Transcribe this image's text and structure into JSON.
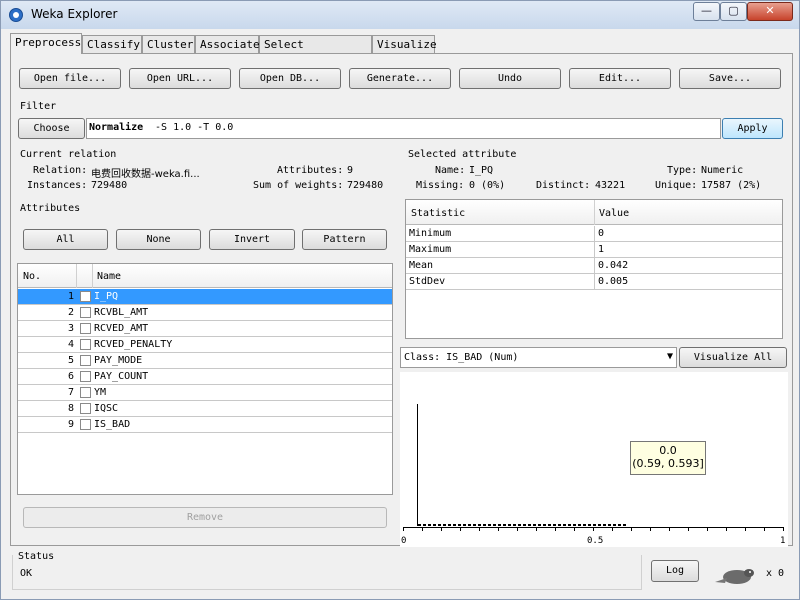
{
  "window": {
    "title": "Weka Explorer",
    "minimize": "—",
    "maximize": "▢",
    "close": "✕"
  },
  "tabs": [
    "Preprocess",
    "Classify",
    "Cluster",
    "Associate",
    "Select attributes",
    "Visualize"
  ],
  "toolbar": {
    "open_file": "Open file...",
    "open_url": "Open URL...",
    "open_db": "Open DB...",
    "generate": "Generate...",
    "undo": "Undo",
    "edit": "Edit...",
    "save": "Save..."
  },
  "filter": {
    "section": "Filter",
    "choose": "Choose",
    "name": "Normalize",
    "args": " -S 1.0 -T 0.0",
    "apply": "Apply"
  },
  "relation": {
    "section": "Current relation",
    "relation_label": "Relation:",
    "relation_value": "电费回收数据-weka.fi...",
    "attributes_label": "Attributes:",
    "attributes_value": "9",
    "instances_label": "Instances:",
    "instances_value": "729480",
    "weights_label": "Sum of weights:",
    "weights_value": "729480"
  },
  "attributes": {
    "section": "Attributes",
    "all": "All",
    "none": "None",
    "invert": "Invert",
    "pattern": "Pattern",
    "col_no": "No.",
    "col_name": "Name",
    "rows": [
      {
        "no": "1",
        "name": "I_PQ"
      },
      {
        "no": "2",
        "name": "RCVBL_AMT"
      },
      {
        "no": "3",
        "name": "RCVED_AMT"
      },
      {
        "no": "4",
        "name": "RCVED_PENALTY"
      },
      {
        "no": "5",
        "name": "PAY_MODE"
      },
      {
        "no": "6",
        "name": "PAY_COUNT"
      },
      {
        "no": "7",
        "name": "YM"
      },
      {
        "no": "8",
        "name": "IQSC"
      },
      {
        "no": "9",
        "name": "IS_BAD"
      }
    ],
    "selected_index": 0,
    "remove": "Remove"
  },
  "selected": {
    "section": "Selected attribute",
    "name_label": "Name:",
    "name_value": "I_PQ",
    "type_label": "Type:",
    "type_value": "Numeric",
    "missing_label": "Missing:",
    "missing_value": "0 (0%)",
    "distinct_label": "Distinct:",
    "distinct_value": "43221",
    "unique_label": "Unique:",
    "unique_value": "17587 (2%)",
    "col_stat": "Statistic",
    "col_value": "Value",
    "stats": [
      {
        "stat": "Minimum",
        "value": "0"
      },
      {
        "stat": "Maximum",
        "value": "1"
      },
      {
        "stat": "Mean",
        "value": "0.042"
      },
      {
        "stat": "StdDev",
        "value": "0.005"
      }
    ]
  },
  "class_select": {
    "value": "Class: IS_BAD (Num)",
    "visualize_all": "Visualize All"
  },
  "histogram": {
    "tooltip_line1": "0.0",
    "tooltip_line2": "(0.59, 0.593]",
    "ticks": [
      "0",
      "0.5",
      "1"
    ]
  },
  "status": {
    "section": "Status",
    "text": "OK",
    "log": "Log",
    "count": "x 0"
  },
  "colors": {
    "selected_row": "#3399ff",
    "tooltip_bg": "#ffffe1"
  }
}
